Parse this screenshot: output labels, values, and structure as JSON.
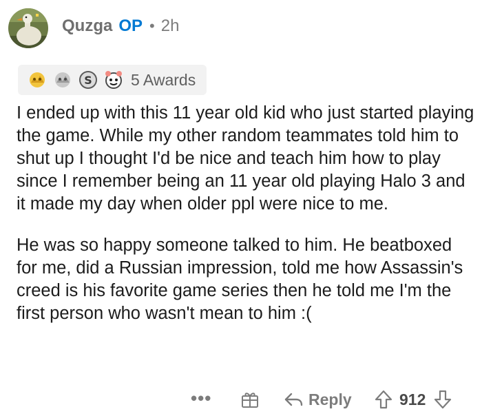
{
  "comment": {
    "username": "Quzga",
    "op_badge": "OP",
    "separator": "•",
    "timestamp": "2h",
    "awards": {
      "icons": [
        "gold-award-icon",
        "silver-award-icon",
        "s-badge-award-icon",
        "wholesome-award-icon"
      ],
      "count_label": "5 Awards"
    },
    "paragraphs": [
      "I ended up with this 11 year old kid who just started playing the game. While my other random teammates told him to shut up I thought I'd be nice and teach him how to play since I remember being an 11 year old playing Halo 3 and it made my day when older ppl were nice to me.",
      "He was so happy someone talked to him. He beatboxed for me, did a Russian impression, told me how Assassin's creed is his favorite game series then he told me I'm the first person who wasn't mean to him :("
    ],
    "actions": {
      "more_label": "•••",
      "reply_label": "Reply",
      "score": "912"
    }
  },
  "colors": {
    "op": "#0079d3",
    "muted": "#7c7c7c",
    "text": "#1c1c1c",
    "award_bg": "#f2f2f2"
  }
}
